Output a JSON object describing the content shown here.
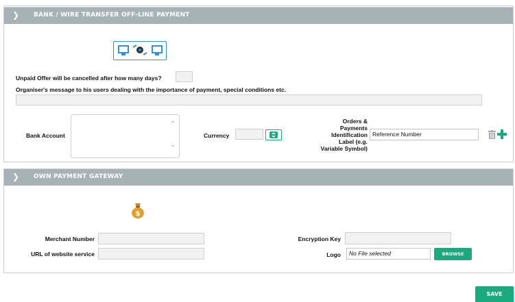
{
  "bank_section": {
    "title": "BANK / WIRE TRANSFER OFF-LINE PAYMENT",
    "collapse_icon": "chevron-down-icon",
    "hero_icon": "computers-exchange-icon",
    "unpaid_label": "Unpaid Offer will be cancelled after how many days?",
    "unpaid_value": "",
    "message_label": "Organiser's message to his users dealing with the importance of payment, special conditions etc.",
    "message_value": "",
    "bank_account_label": "Bank Account",
    "bank_account_value": "",
    "currency_label": "Currency",
    "currency_value": "",
    "orders_label_lines": [
      "Orders &",
      "Payments",
      "Identification",
      "Label (e.g.",
      "Variable Symbol)"
    ],
    "orders_value": "Reference Number",
    "delete_icon": "trash-icon",
    "add_icon": "plus-icon"
  },
  "gateway_section": {
    "title": "OWN PAYMENT GATEWAY",
    "collapse_icon": "chevron-down-icon",
    "hero_icon": "money-bag-icon",
    "merchant_label": "Merchant Number",
    "merchant_value": "",
    "url_label": "URL of website service",
    "url_value": "",
    "encryption_label": "Encryption Key",
    "encryption_value": "",
    "logo_label": "Logo",
    "logo_file_value": "No File selected",
    "browse_label": "BROWSE"
  },
  "save_label": "SAVE",
  "colors": {
    "header": "#a6b2b6",
    "accent": "#1aaa7e",
    "icon_blue": "#2f8fd8"
  }
}
